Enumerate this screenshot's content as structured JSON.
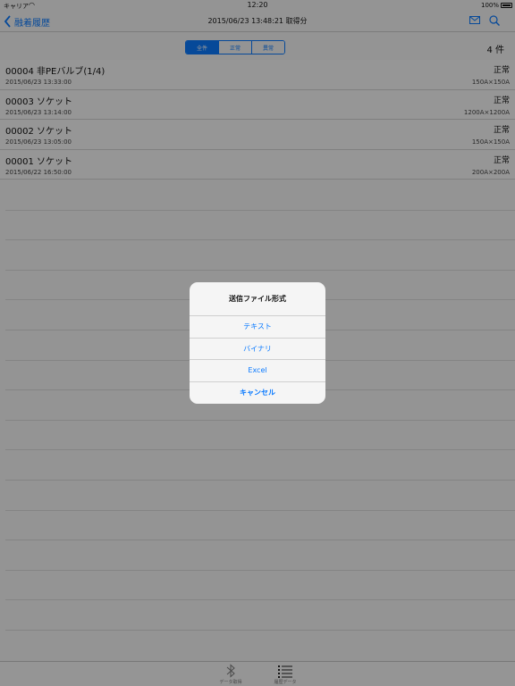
{
  "status_bar": {
    "carrier": "キャリア",
    "time": "12:20",
    "battery": "100%"
  },
  "nav": {
    "back_label": "融着履歴",
    "title": "2015/06/23 13:48:21 取得分"
  },
  "segments": {
    "all": "全件",
    "normal": "正常",
    "abnormal": "異常",
    "selected": "全件"
  },
  "count": "4 件",
  "records": [
    {
      "title": "00004 非PEバルブ(1/4)",
      "date": "2015/06/23 13:33:00",
      "status": "正常",
      "size": "150A×150A"
    },
    {
      "title": "00003 ソケット",
      "date": "2015/06/23 13:14:00",
      "status": "正常",
      "size": "1200A×1200A"
    },
    {
      "title": "00002 ソケット",
      "date": "2015/06/23 13:05:00",
      "status": "正常",
      "size": "150A×150A"
    },
    {
      "title": "00001 ソケット",
      "date": "2015/06/22 16:50:00",
      "status": "正常",
      "size": "200A×200A"
    }
  ],
  "tabs": {
    "data_label": "データ取得",
    "history_label": "履歴データ"
  },
  "alert": {
    "title": "送信ファイル形式",
    "option_text": "テキスト",
    "option_binary": "バイナリ",
    "option_excel": "Excel",
    "cancel": "キャンセル"
  },
  "colors": {
    "accent": "#0a7aff",
    "overlay": "rgba(0,0,0,0.4)"
  }
}
